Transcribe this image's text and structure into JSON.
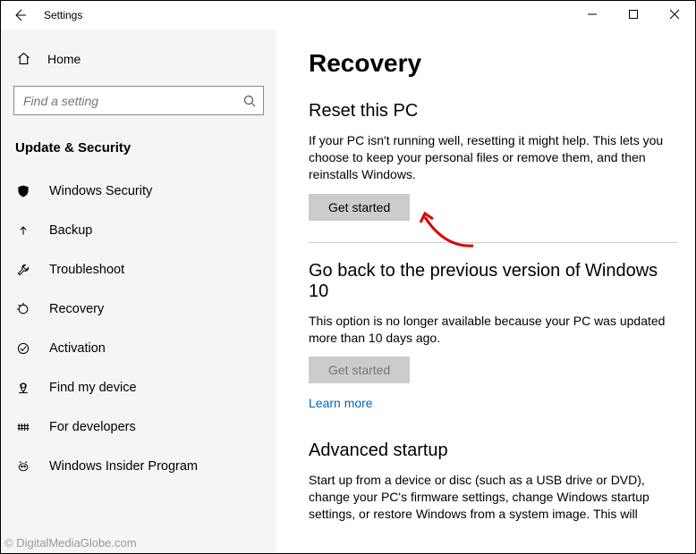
{
  "window": {
    "title": "Settings"
  },
  "sidebar": {
    "home_label": "Home",
    "search_placeholder": "Find a setting",
    "category": "Update & Security",
    "items": [
      {
        "label": "Windows Security"
      },
      {
        "label": "Backup"
      },
      {
        "label": "Troubleshoot"
      },
      {
        "label": "Recovery"
      },
      {
        "label": "Activation"
      },
      {
        "label": "Find my device"
      },
      {
        "label": "For developers"
      },
      {
        "label": "Windows Insider Program"
      }
    ]
  },
  "page": {
    "title": "Recovery",
    "reset": {
      "heading": "Reset this PC",
      "body": "If your PC isn't running well, resetting it might help. This lets you choose to keep your personal files or remove them, and then reinstalls Windows.",
      "button": "Get started"
    },
    "goback": {
      "heading": "Go back to the previous version of Windows 10",
      "body": "This option is no longer available because your PC was updated more than 10 days ago.",
      "button": "Get started",
      "learn_more": "Learn more"
    },
    "advanced": {
      "heading": "Advanced startup",
      "body": "Start up from a device or disc (such as a USB drive or DVD), change your PC's firmware settings, change Windows startup settings, or restore Windows from a system image. This will"
    }
  },
  "watermark": "© DigitalMediaGlobe.com"
}
